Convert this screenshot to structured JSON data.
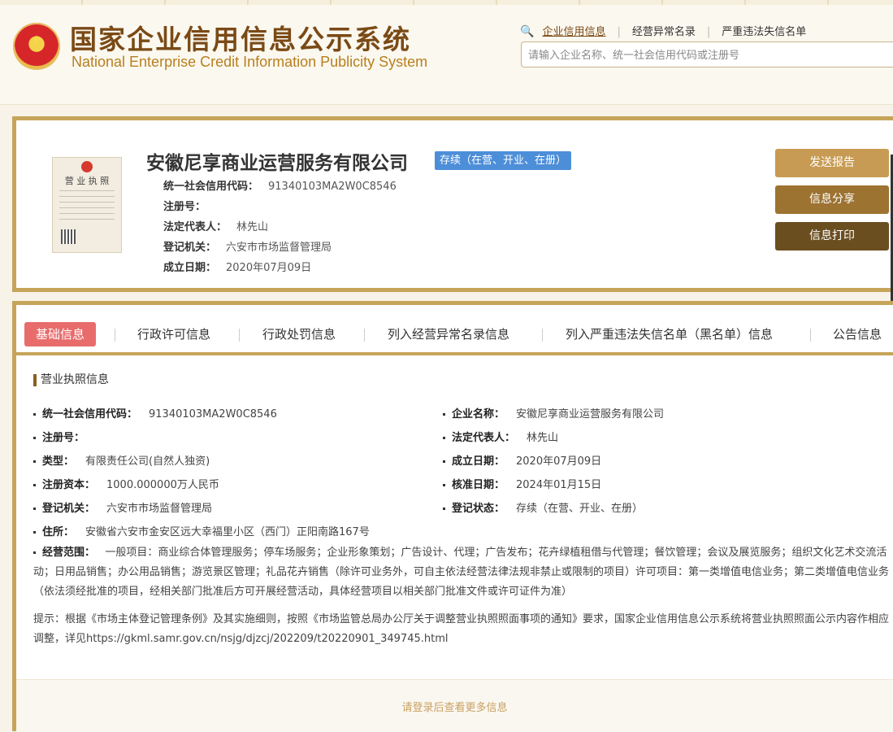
{
  "header": {
    "title": "国家企业信用信息公示系统",
    "subtitle": "National Enterprise Credit Information Publicity System",
    "links": [
      "企业信用信息",
      "经营异常名录",
      "严重违法失信名单"
    ],
    "search_placeholder": "请输入企业名称、统一社会信用代码或注册号"
  },
  "company": {
    "name": "安徽尼享商业运营服务有限公司",
    "status": "存续（在营、开业、在册）",
    "license_title": "营 业 执 照",
    "rows": [
      {
        "label": "统一社会信用代码：",
        "value": "91340103MA2W0C8546"
      },
      {
        "label": "注册号：",
        "value": ""
      },
      {
        "label": "法定代表人：",
        "value": "林先山"
      },
      {
        "label": "登记机关：",
        "value": "六安市市场监督管理局"
      },
      {
        "label": "成立日期：",
        "value": "2020年07月09日"
      }
    ],
    "buttons": {
      "send": "发送报告",
      "share": "信息分享",
      "print": "信息打印"
    }
  },
  "tabs": [
    "基础信息",
    "行政许可信息",
    "行政处罚信息",
    "列入经营异常名录信息",
    "列入严重违法失信名单（黑名单）信息",
    "公告信息"
  ],
  "license_section": {
    "title": "营业执照信息",
    "left": [
      {
        "label": "统一社会信用代码：",
        "value": "91340103MA2W0C8546"
      },
      {
        "label": "注册号：",
        "value": ""
      },
      {
        "label": "类型：",
        "value": "有限责任公司(自然人独资)"
      },
      {
        "label": "注册资本：",
        "value": "1000.000000万人民币"
      },
      {
        "label": "登记机关：",
        "value": "六安市市场监督管理局"
      },
      {
        "label": "住所：",
        "value": "安徽省六安市金安区远大幸福里小区（西门）正阳南路167号"
      }
    ],
    "right": [
      {
        "label": "企业名称：",
        "value": "安徽尼享商业运营服务有限公司"
      },
      {
        "label": "法定代表人：",
        "value": "林先山"
      },
      {
        "label": "成立日期：",
        "value": "2020年07月09日"
      },
      {
        "label": "核准日期：",
        "value": "2024年01月15日"
      },
      {
        "label": "登记状态：",
        "value": "存续（在营、开业、在册）"
      }
    ],
    "scope_label": "经营范围：",
    "scope_value": "一般项目：商业综合体管理服务；停车场服务；企业形象策划；广告设计、代理；广告发布；花卉绿植租借与代管理；餐饮管理；会议及展览服务；组织文化艺术交流活动；日用品销售；办公用品销售；游览景区管理；礼品花卉销售（除许可业务外，可自主依法经营法律法规非禁止或限制的项目）许可项目：第一类增值电信业务；第二类增值电信业务（依法须经批准的项目，经相关部门批准后方可开展经营活动，具体经营项目以相关部门批准文件或许可证件为准）",
    "note": "提示：根据《市场主体登记管理条例》及其实施细则，按照《市场监管总局办公厅关于调整营业执照照面事项的通知》要求，国家企业信用信息公示系统将营业执照照面公示内容作相应调整，详见https://gkml.samr.gov.cn/nsjg/djzcj/202209/t20220901_349745.html"
  },
  "footer": {
    "login_hint": "请登录后查看更多信息"
  }
}
